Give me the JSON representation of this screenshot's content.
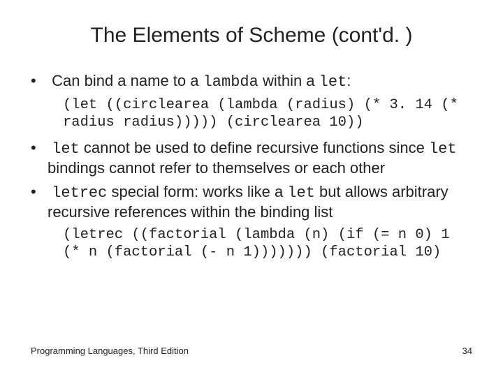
{
  "title": "The Elements of Scheme (cont'd. )",
  "bullets": {
    "b1_pre": "Can bind a name to a ",
    "b1_code1": "lambda",
    "b1_mid": " within a ",
    "b1_code2": "let",
    "b1_post": ":",
    "code1": "(let ((circlearea (lambda (radius) (* 3. 14 (* radius radius))))) (circlearea 10))",
    "b2_code": "let",
    "b2_mid1": " cannot be used to define recursive functions since ",
    "b2_code2": "let",
    "b2_mid2": " bindings cannot refer to themselves or each other",
    "b3_code": "letrec",
    "b3_mid1": " special form: works like a ",
    "b3_code2": "let",
    "b3_mid2": " but allows arbitrary recursive references within the binding list",
    "code2": "(letrec ((factorial (lambda (n) (if (= n 0) 1 (* n (factorial (- n 1))))))) (factorial 10)"
  },
  "footer": {
    "left": "Programming Languages, Third Edition",
    "right": "34"
  }
}
